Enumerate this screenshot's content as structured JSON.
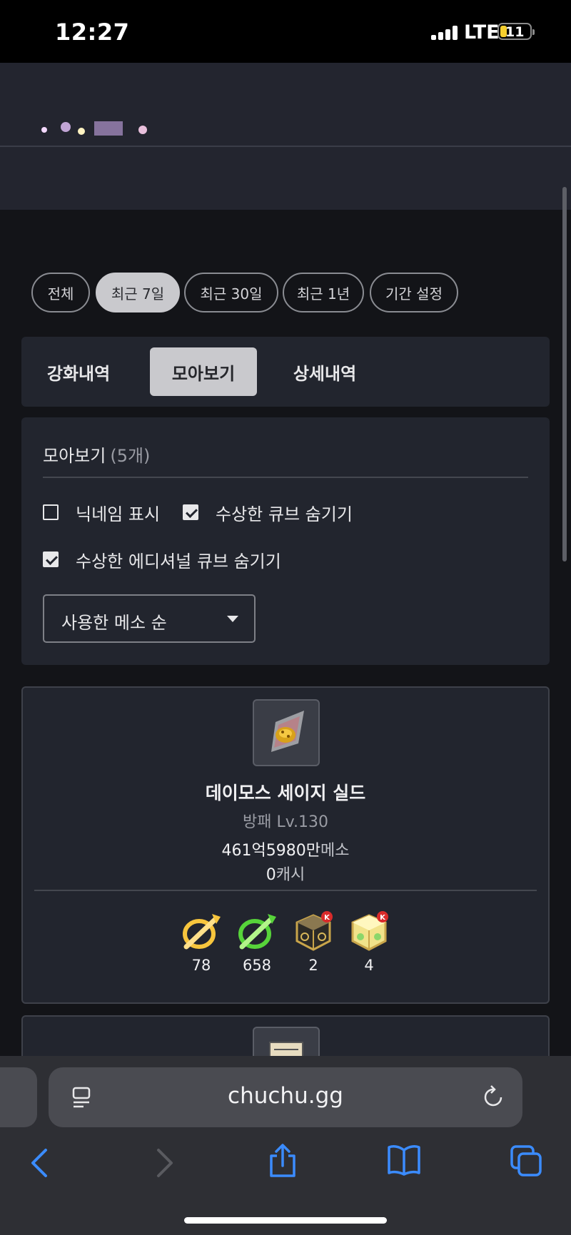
{
  "status": {
    "time": "12:27",
    "network": "LTE",
    "battery": "11"
  },
  "filters": [
    "전체",
    "최근 7일",
    "최근 30일",
    "최근 1년",
    "기간 설정"
  ],
  "filters_active_index": 1,
  "tabs": [
    "강화내역",
    "모아보기",
    "상세내역"
  ],
  "tabs_active_index": 1,
  "panel": {
    "title": "모아보기",
    "count": "(5개)",
    "options": [
      {
        "label": "닉네임 표시",
        "checked": false
      },
      {
        "label": "수상한 큐브 숨기기",
        "checked": true
      },
      {
        "label": "수상한 에디셔널 큐브 숨기기",
        "checked": true
      }
    ],
    "sort_label": "사용한 메소 순"
  },
  "item": {
    "name": "데이모스 세이지 실드",
    "type": "방패 Lv.130",
    "meso_value": "461억5980만",
    "meso_unit": "메소",
    "cash_value": "0",
    "cash_unit": "캐시",
    "cubes": [
      {
        "icon": "gold-hammer-icon",
        "count": "78"
      },
      {
        "icon": "green-hammer-icon",
        "count": "658"
      },
      {
        "icon": "black-cube-icon",
        "count": "2"
      },
      {
        "icon": "additional-cube-icon",
        "count": "4"
      }
    ]
  },
  "browser": {
    "url": "chuchu.gg"
  },
  "colors": {
    "background": "#131418",
    "panel": "#22252e",
    "chip_active": "#c9c9cd",
    "link_blue": "#3b8cff"
  }
}
